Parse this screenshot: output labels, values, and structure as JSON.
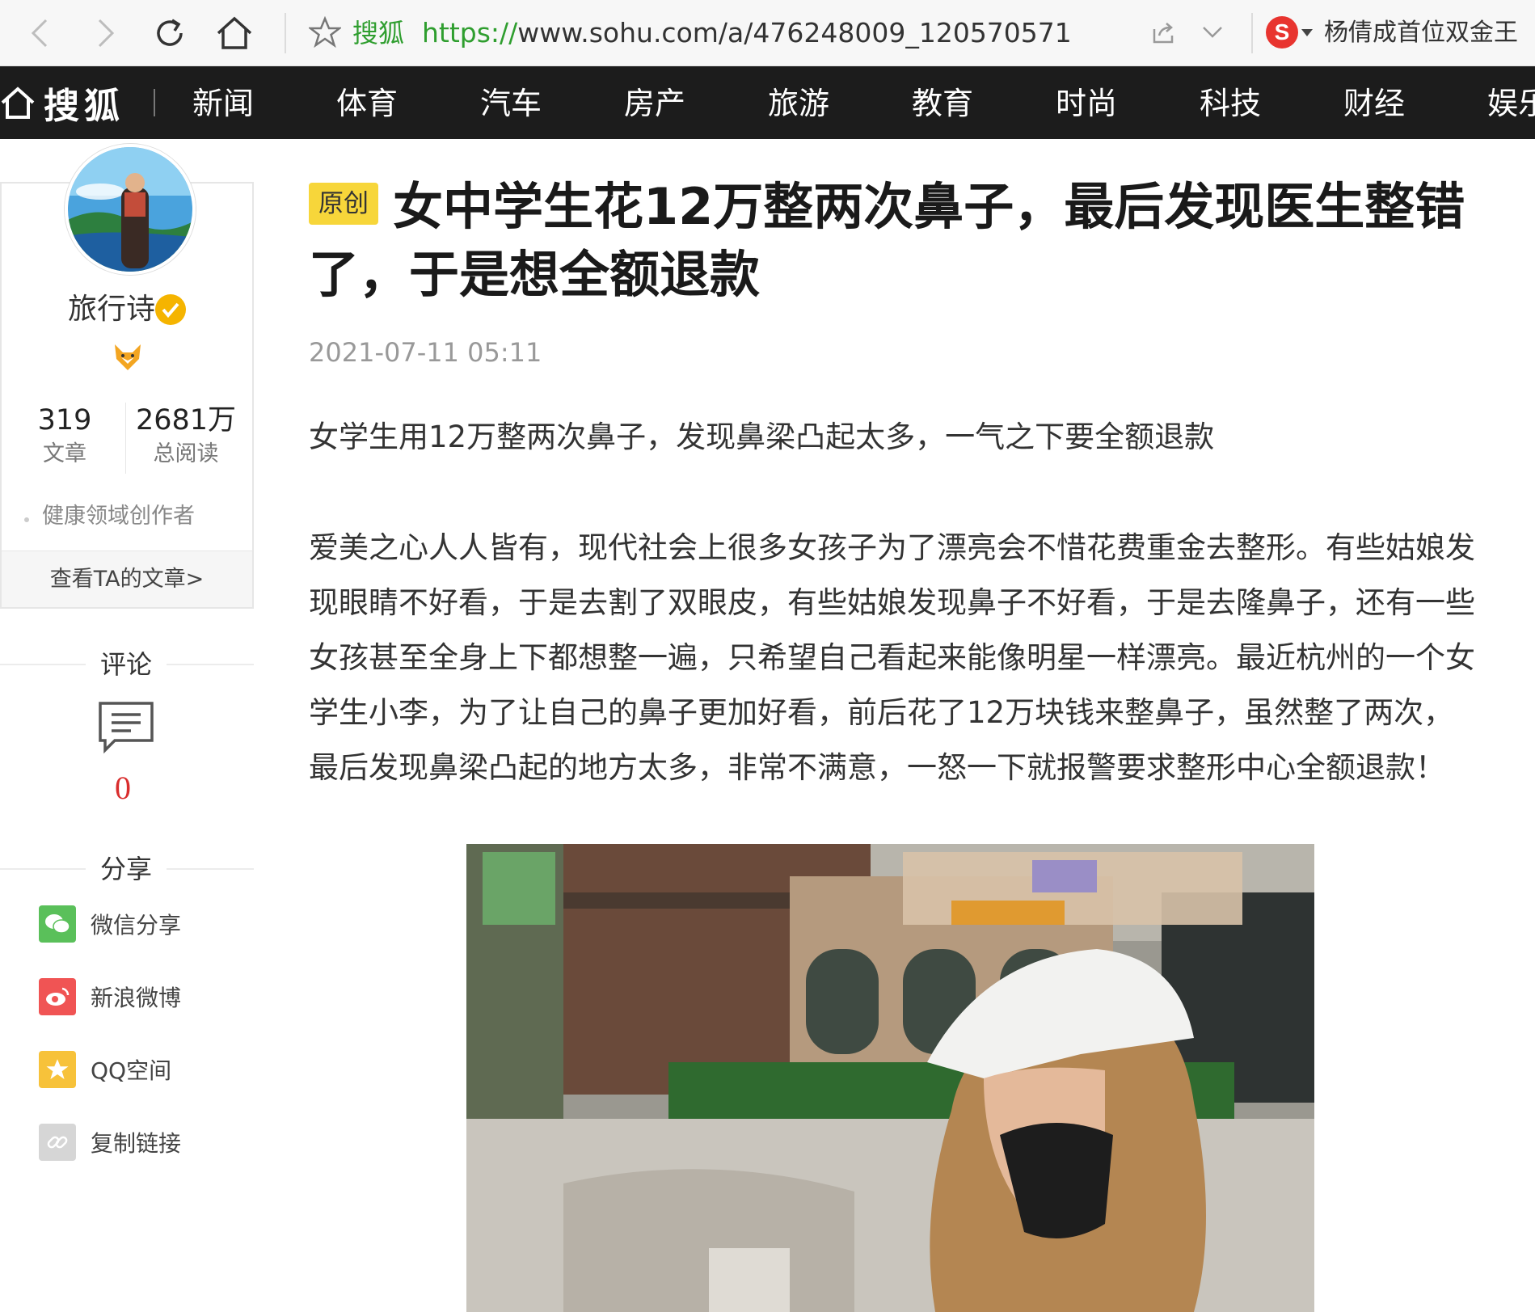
{
  "browser": {
    "site_name": "搜狐",
    "url_scheme": "https://",
    "url_rest": "www.sohu.com/a/476248009_120570571",
    "search_engine_glyph": "S",
    "hot_search": "杨倩成首位双金王"
  },
  "site_nav": {
    "logo": "搜狐",
    "items": [
      "新闻",
      "体育",
      "汽车",
      "房产",
      "旅游",
      "教育",
      "时尚",
      "科技",
      "财经",
      "娱乐"
    ]
  },
  "author": {
    "name": "旅行诗",
    "articles_count": "319",
    "articles_label": "文章",
    "reads_count": "2681万",
    "reads_label": "总阅读",
    "domain": "健康领域创作者",
    "view_articles": "查看TA的文章>"
  },
  "comments": {
    "label": "评论",
    "count": "0"
  },
  "share": {
    "label": "分享",
    "items": [
      {
        "label": "微信分享",
        "icon": "wechat-icon",
        "color": "#5ac05a"
      },
      {
        "label": "新浪微博",
        "icon": "weibo-icon",
        "color": "#f05454"
      },
      {
        "label": "QQ空间",
        "icon": "qzone-icon",
        "color": "#f7c23a"
      },
      {
        "label": "复制链接",
        "icon": "link-icon",
        "color": "#d6d6d6"
      }
    ]
  },
  "article": {
    "badge": "原创",
    "title": "女中学生花12万整两次鼻子，最后发现医生整错了，于是想全额退款",
    "time": "2021-07-11 05:11",
    "lead": "女学生用12万整两次鼻子，发现鼻梁凸起太多，一气之下要全额退款",
    "paragraph": "爱美之心人人皆有，现代社会上很多女孩子为了漂亮会不惜花费重金去整形。有些姑娘发现眼睛不好看，于是去割了双眼皮，有些姑娘发现鼻子不好看，于是去隆鼻子，还有一些女孩甚至全身上下都想整一遍，只希望自己看起来能像明星一样漂亮。最近杭州的一个女学生小李，为了让自己的鼻子更加好看，前后花了12万块钱来整鼻子，虽然整了两次，最后发现鼻梁凸起的地方太多，非常不满意，一怒一下就报警要求整形中心全额退款！"
  },
  "colors": {
    "nav_bg": "#1c1c1c",
    "badge_yellow": "#f7d63a",
    "comment_red": "#d92d2d",
    "url_green": "#2f9e2f"
  }
}
